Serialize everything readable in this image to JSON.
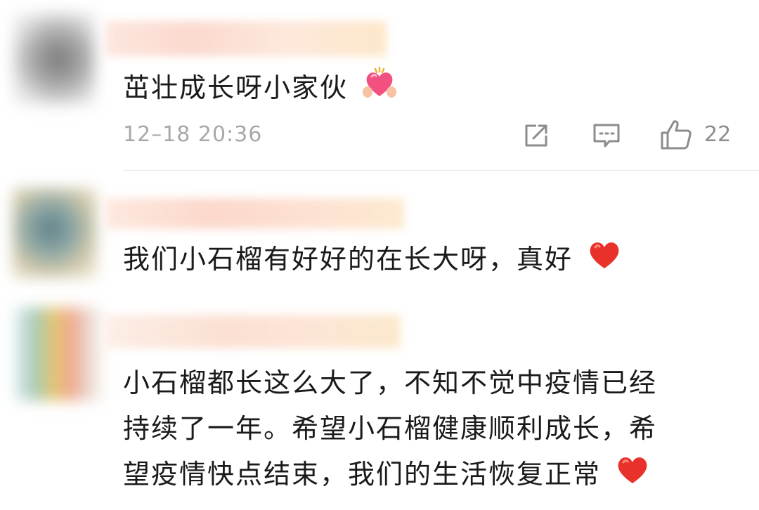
{
  "comments": [
    {
      "text": "茁壮成长呀小家伙",
      "emoji": "heart-hands-emoji",
      "timestamp": "12–18 20:36",
      "likes": "22"
    },
    {
      "text": "我们小石榴有好好的在长大呀，真好",
      "emoji": "red-heart-emoji"
    },
    {
      "lines": [
        "小石榴都长这么大了，不知不觉中疫情已经",
        "持续了一年。希望小石榴健康顺利成长，希",
        "望疫情快点结束，我们的生活恢复正常"
      ],
      "emoji": "red-heart-emoji"
    }
  ],
  "icons": {
    "share": "share-icon",
    "reply": "comment-icon",
    "like": "thumbs-up-icon"
  },
  "colors": {
    "text": "#1a1a1a",
    "meta": "#a8a8a8",
    "divider": "#e8e8e8",
    "heart": "#e8312a"
  }
}
